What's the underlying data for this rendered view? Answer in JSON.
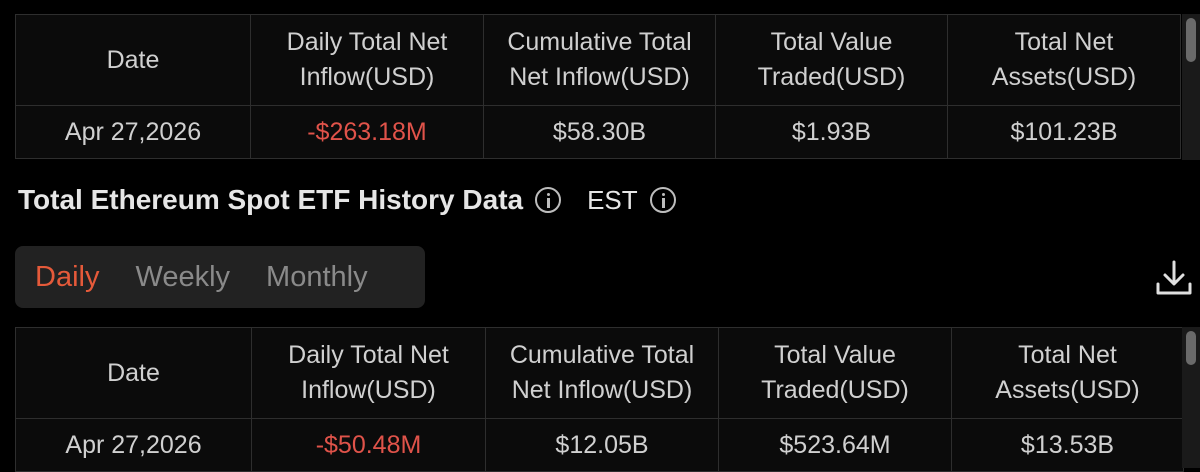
{
  "columns": [
    "Date",
    "Daily Total Net\nInflow(USD)",
    "Cumulative Total\nNet Inflow(USD)",
    "Total Value\nTraded(USD)",
    "Total Net\nAssets(USD)"
  ],
  "btc_table": {
    "headers": {
      "date": "Date",
      "daily_l1": "Daily Total Net",
      "daily_l2": "Inflow(USD)",
      "cum_l1": "Cumulative Total",
      "cum_l2": "Net Inflow(USD)",
      "traded_l1": "Total Value",
      "traded_l2": "Traded(USD)",
      "assets_l1": "Total Net",
      "assets_l2": "Assets(USD)"
    },
    "row": {
      "date": "Apr 27,2026",
      "daily": "-$263.18M",
      "cumulative": "$58.30B",
      "traded": "$1.93B",
      "assets": "$101.23B"
    }
  },
  "eth_section": {
    "title": "Total Ethereum Spot ETF History Data",
    "timezone": "EST",
    "tabs": [
      "Daily",
      "Weekly",
      "Monthly"
    ],
    "active_tab": "Daily"
  },
  "eth_table": {
    "headers": {
      "date": "Date",
      "daily_l1": "Daily Total Net",
      "daily_l2": "Inflow(USD)",
      "cum_l1": "Cumulative Total",
      "cum_l2": "Net Inflow(USD)",
      "traded_l1": "Total Value",
      "traded_l2": "Traded(USD)",
      "assets_l1": "Total Net",
      "assets_l2": "Assets(USD)"
    },
    "row": {
      "date": "Apr 27,2026",
      "daily": "-$50.48M",
      "cumulative": "$12.05B",
      "traded": "$523.64M",
      "assets": "$13.53B"
    }
  },
  "colors": {
    "negative": "#e0534a",
    "active_tab": "#e55a3a"
  }
}
